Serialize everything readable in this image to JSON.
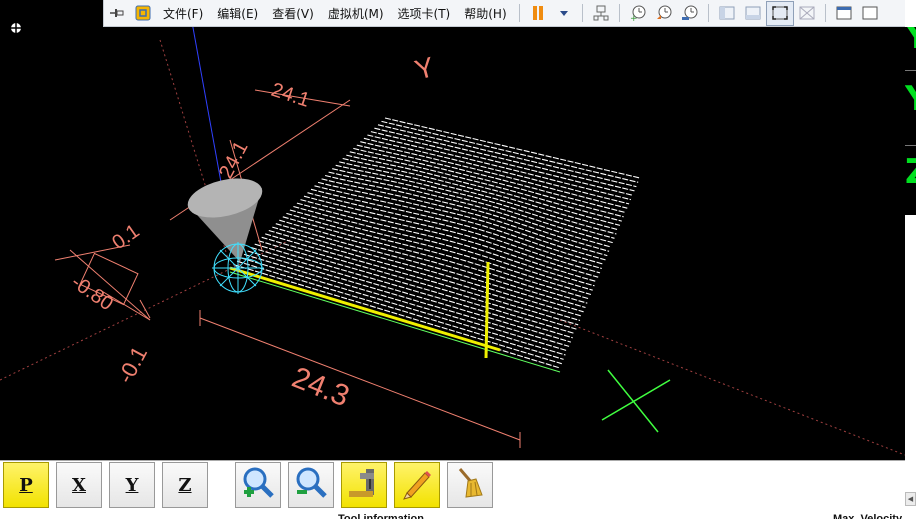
{
  "vm_toolbar": {
    "menus": [
      "文件(F)",
      "编辑(E)",
      "查看(V)",
      "虚拟机(M)",
      "选项卡(T)",
      "帮助(H)"
    ],
    "icons": [
      "pin-icon",
      "vmware-logo-icon",
      "pause-icon",
      "dropdown-icon",
      "network-icon",
      "snapshot-take-icon",
      "snapshot-revert-icon",
      "snapshot-manager-icon",
      "view-sidebar-icon",
      "view-thumbnail-icon",
      "fullscreen-icon",
      "unity-icon",
      "console-view-icon",
      "stretch-icon"
    ]
  },
  "viewport": {
    "dimensions": {
      "x_length": "24.3",
      "y_length": "24.1",
      "y_length_top": "24.1",
      "left_offset": "0.1",
      "left_offset_neg": "-0.1",
      "z_value": "-0.80"
    },
    "axis_labels": {
      "y": "Y",
      "x": "X"
    },
    "colors": {
      "background": "#000000",
      "dimension": "#f08070",
      "toolpath": "#ffffff",
      "highlight": "#f0f000",
      "x_axis": "#40ff40",
      "z_axis": "#3040ff",
      "tool_glyph": "#40e0ff",
      "tool_cone": "#9a9a9a"
    }
  },
  "dro": {
    "letters": [
      "Y",
      "Y",
      "Z"
    ]
  },
  "bottom_toolbar": {
    "buttons": [
      {
        "label": "P",
        "name": "view-perspective-button",
        "active": true
      },
      {
        "label": "X",
        "name": "view-x-button",
        "active": false
      },
      {
        "label": "Y",
        "name": "view-y-button",
        "active": false
      },
      {
        "label": "Z",
        "name": "view-z-button",
        "active": false
      }
    ],
    "tools": [
      "zoom-in-icon",
      "zoom-out-icon",
      "machine-tool-icon",
      "pencil-icon",
      "broom-icon"
    ]
  },
  "footer": {
    "left_text": "Tool information",
    "right_text": "Max. Velocity"
  }
}
